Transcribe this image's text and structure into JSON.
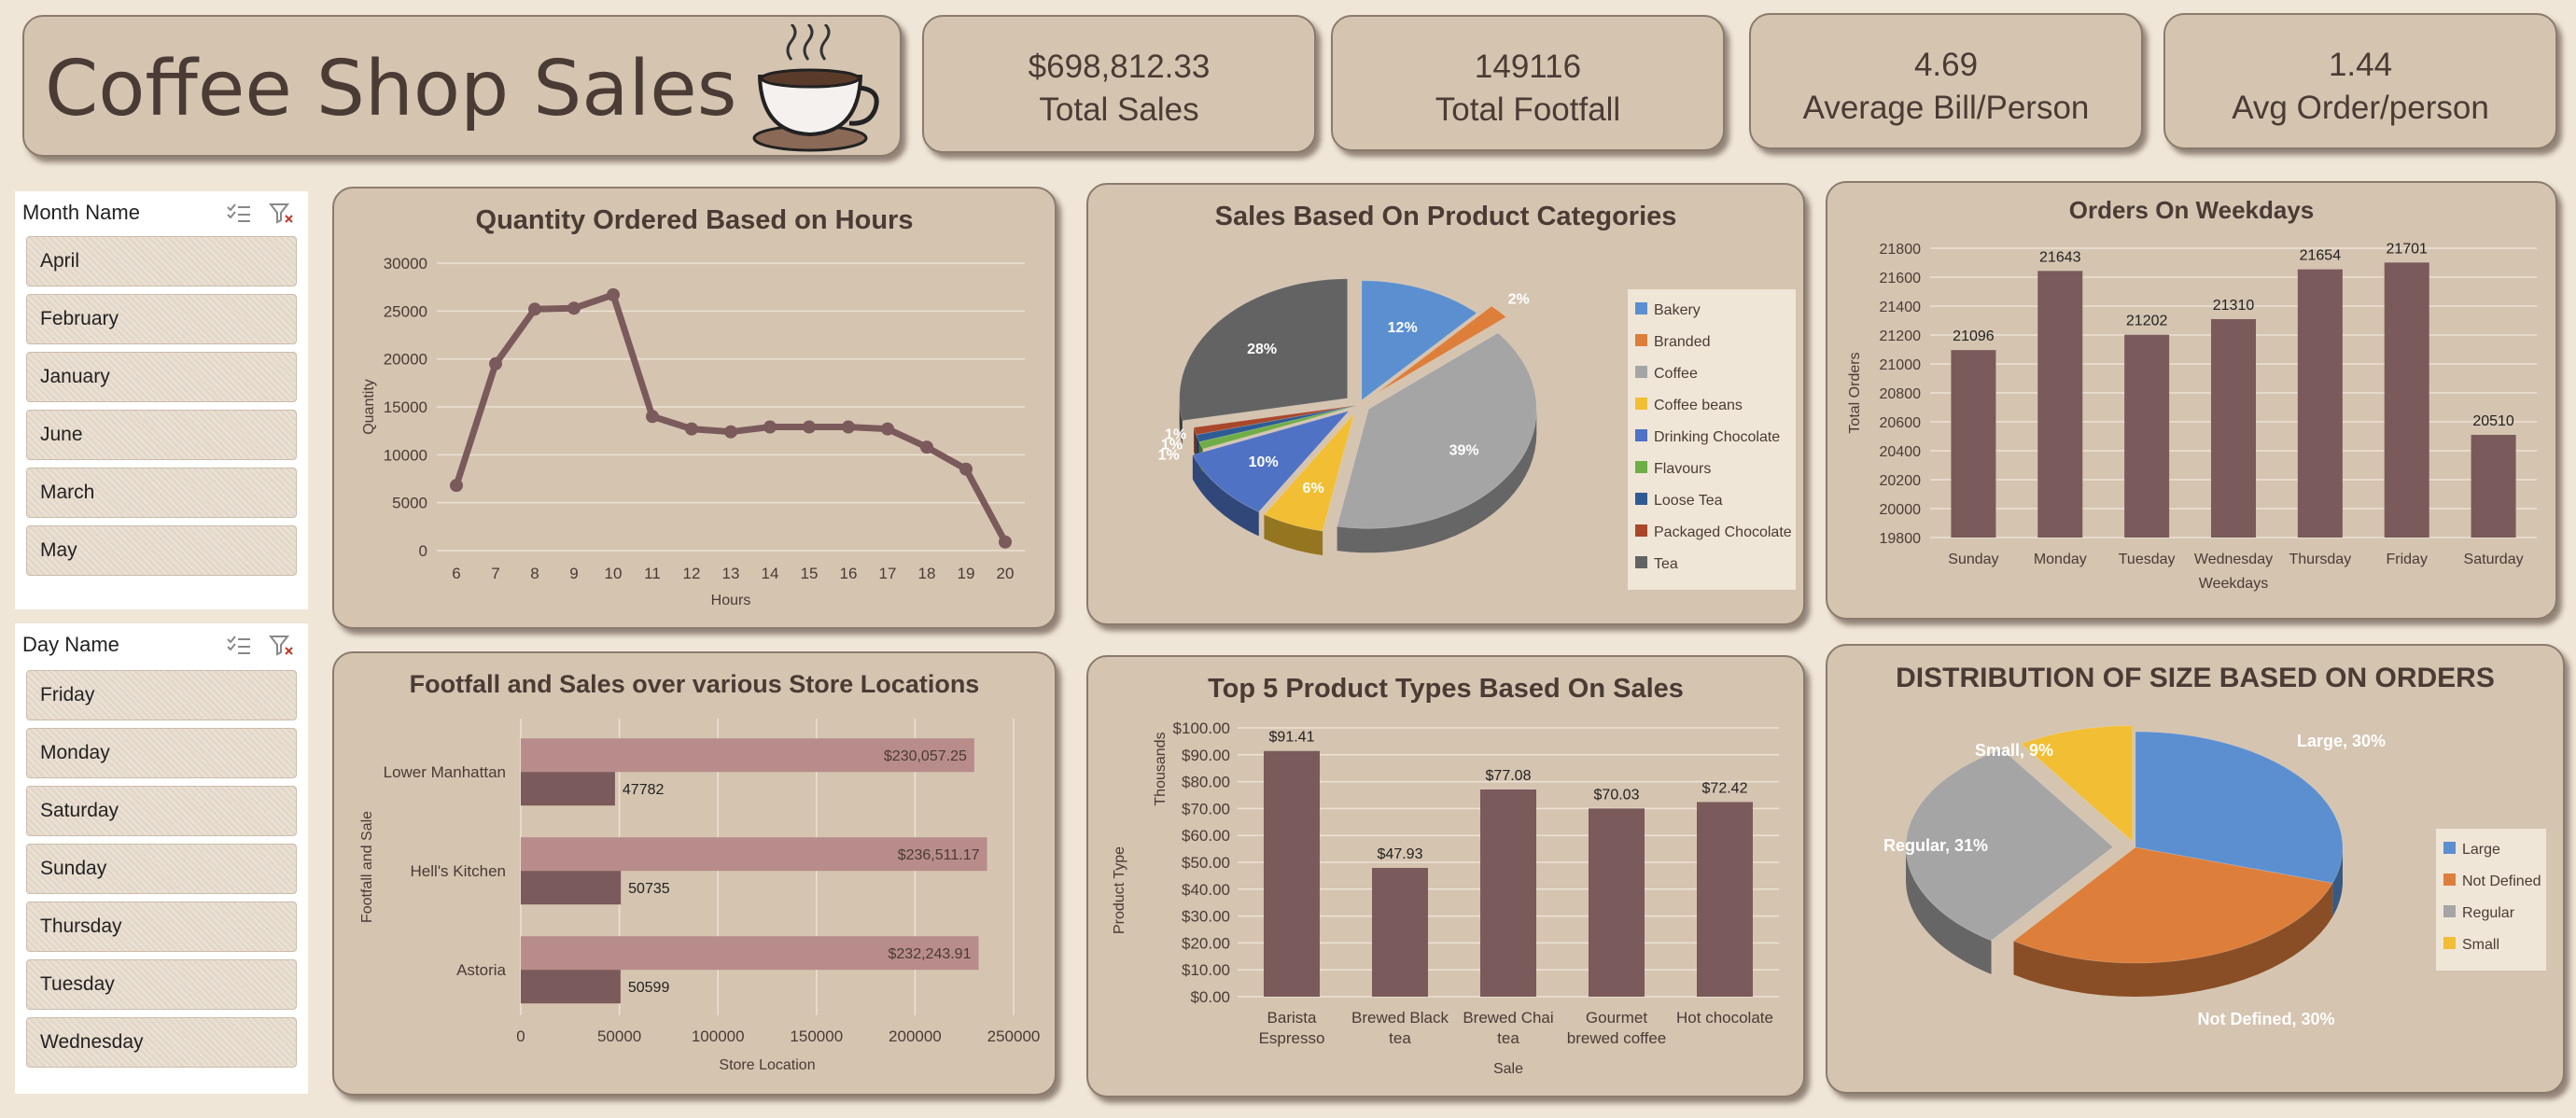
{
  "header": {
    "title": "Coffee Shop Sales",
    "logo_icon": "coffee-cup-icon"
  },
  "kpis": [
    {
      "value": "$698,812.33",
      "label": "Total Sales"
    },
    {
      "value": "149116",
      "label": "Total Footfall"
    },
    {
      "value": "4.69",
      "label": "Average Bill/Person"
    },
    {
      "value": "1.44",
      "label": "Avg Order/person"
    }
  ],
  "slicers": {
    "month": {
      "title": "Month Name",
      "items": [
        "April",
        "February",
        "January",
        "June",
        "March",
        "May"
      ]
    },
    "day": {
      "title": "Day Name",
      "items": [
        "Friday",
        "Monday",
        "Saturday",
        "Sunday",
        "Thursday",
        "Tuesday",
        "Wednesday"
      ]
    }
  },
  "colors": {
    "background": "#efe6d7",
    "card": "#d5c4b0",
    "bar": "#7a5a5b",
    "bar_light": "#b88c8a",
    "text": "#4a3b35"
  },
  "chart_data": [
    {
      "id": "hours",
      "type": "line",
      "title": "Quantity Ordered Based on Hours",
      "xlabel": "Hours",
      "ylabel": "Quantity",
      "x": [
        6,
        7,
        8,
        9,
        10,
        11,
        12,
        13,
        14,
        15,
        16,
        17,
        18,
        19,
        20
      ],
      "values": [
        6800,
        19500,
        25200,
        25300,
        26700,
        14000,
        12700,
        12400,
        12900,
        12900,
        12900,
        12700,
        10800,
        8500,
        900
      ],
      "ylim": [
        0,
        30000
      ],
      "yticks": [
        0,
        5000,
        10000,
        15000,
        20000,
        25000,
        30000
      ],
      "grid": true
    },
    {
      "id": "categories",
      "type": "pie",
      "title": "Sales Based On Product Categories",
      "categories": [
        "Bakery",
        "Branded",
        "Coffee",
        "Coffee beans",
        "Drinking Chocolate",
        "Flavours",
        "Loose Tea",
        "Packaged Chocolate",
        "Tea"
      ],
      "values": [
        12,
        2,
        39,
        6,
        10,
        1,
        1,
        1,
        28
      ],
      "labels": [
        "12%",
        "2%",
        "39%",
        "6%",
        "10%",
        "1%",
        "1%",
        "1%",
        "28%"
      ],
      "colors": [
        "#5b8fd0",
        "#dd7e3b",
        "#a5a5a5",
        "#f1be34",
        "#4f72c4",
        "#6fad47",
        "#2e5b94",
        "#a8472a",
        "#636363"
      ],
      "legend": "right"
    },
    {
      "id": "weekdays",
      "type": "bar",
      "title": "Orders On Weekdays",
      "xlabel": "Weekdays",
      "ylabel": "Total Orders",
      "categories": [
        "Sunday",
        "Monday",
        "Tuesday",
        "Wednesday",
        "Thursday",
        "Friday",
        "Saturday"
      ],
      "values": [
        21096,
        21643,
        21202,
        21310,
        21654,
        21701,
        20510
      ],
      "ylim": [
        19800,
        21800
      ],
      "yticks": [
        19800,
        20000,
        20200,
        20400,
        20600,
        20800,
        21000,
        21200,
        21400,
        21600,
        21800
      ],
      "grid": true
    },
    {
      "id": "locations",
      "type": "bar",
      "orientation": "horizontal",
      "title": "Footfall and Sales over various Store Locations",
      "xlabel": "Store Location",
      "ylabel": "Footfall and Sale",
      "categories": [
        "Lower Manhattan",
        "Hell's Kitchen",
        "Astoria"
      ],
      "series": [
        {
          "values": [
            230057.25,
            236511.17,
            232243.91
          ],
          "labels": [
            "$230,057.25",
            "$236,511.17",
            "$232,243.91"
          ]
        },
        {
          "values": [
            47782,
            50735,
            50599
          ],
          "labels": [
            "47782",
            "50735",
            "50599"
          ]
        }
      ],
      "xlim": [
        0,
        250000
      ],
      "xticks": [
        0,
        50000,
        100000,
        150000,
        200000,
        250000
      ],
      "grid": true
    },
    {
      "id": "products",
      "type": "bar",
      "title": "Top 5 Product Types Based On Sales",
      "xlabel": "Sale",
      "ylabel": "Product Type",
      "unit_label": "Thousands",
      "categories": [
        [
          "Barista",
          "Espresso"
        ],
        [
          "Brewed Black",
          "tea"
        ],
        [
          "Brewed Chai",
          "tea"
        ],
        [
          "Gourmet",
          "brewed coffee"
        ],
        [
          "Hot chocolate"
        ]
      ],
      "values": [
        91.41,
        47.93,
        77.08,
        70.03,
        72.42
      ],
      "labels": [
        "$91.41",
        "$47.93",
        "$77.08",
        "$70.03",
        "$72.42"
      ],
      "ylim": [
        0,
        100
      ],
      "yticks": [
        "$0.00",
        "$10.00",
        "$20.00",
        "$30.00",
        "$40.00",
        "$50.00",
        "$60.00",
        "$70.00",
        "$80.00",
        "$90.00",
        "$100.00"
      ],
      "grid": true
    },
    {
      "id": "sizes",
      "type": "pie",
      "title": "DISTRIBUTION OF SIZE BASED ON ORDERS",
      "categories": [
        "Large",
        "Not Defined",
        "Regular",
        "Small"
      ],
      "values": [
        30,
        30,
        31,
        9
      ],
      "labels": [
        "Large, 30%",
        "Not Defined, 30%",
        "Regular, 31%",
        "Small, 9%"
      ],
      "colors": [
        "#5b8fd0",
        "#dd7e3b",
        "#a5a5a5",
        "#f1be34"
      ],
      "legend": "right"
    }
  ]
}
